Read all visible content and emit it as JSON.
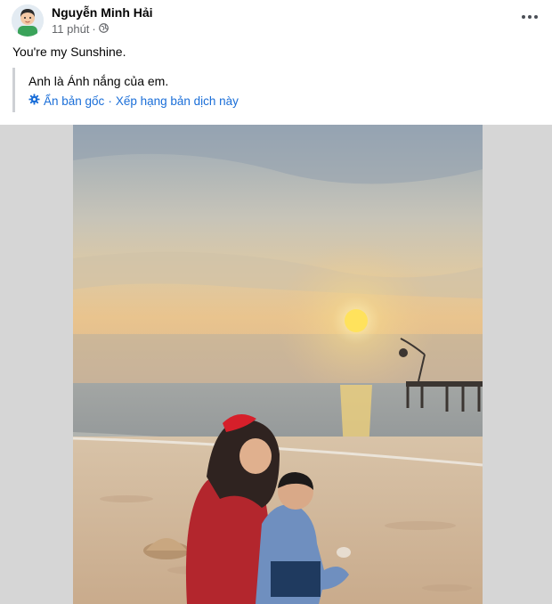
{
  "post": {
    "author": "Nguyễn Minh Hải",
    "time": "11 phút",
    "separator": "·",
    "privacy_icon": "globe-icon",
    "more_icon": "more-horizontal-icon",
    "text": "You're my Sunshine.",
    "translation": {
      "text": "Anh là Ánh nắng của em.",
      "settings_icon": "gear-icon",
      "hide_original": "Ẩn bản gốc",
      "separator": "·",
      "rate_translation": "Xếp hạng bản dịch này"
    },
    "photo": {
      "subject": "sunset-beach-photo"
    }
  },
  "colors": {
    "link": "#1a6ed8",
    "author": "#050505",
    "meta": "#65676b",
    "media_background": "#d6d6d6"
  }
}
